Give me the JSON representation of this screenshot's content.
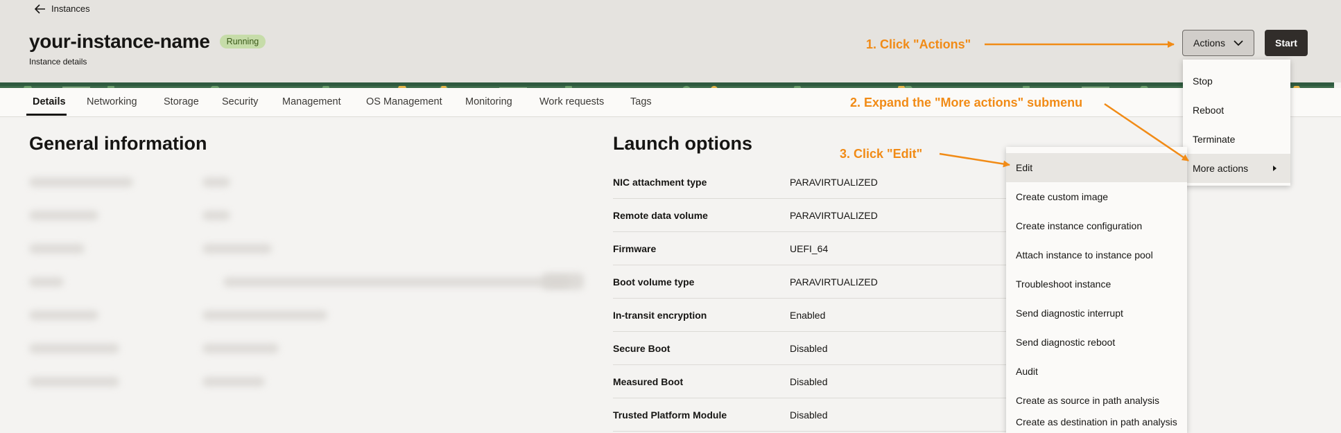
{
  "breadcrumb": {
    "back_label": "Instances"
  },
  "instance": {
    "name": "your-instance-name",
    "status": "Running",
    "subtitle": "Instance details"
  },
  "header_buttons": {
    "actions_label": "Actions",
    "start_label": "Start"
  },
  "tabs": [
    "Details",
    "Networking",
    "Storage",
    "Security",
    "Management",
    "OS Management",
    "Monitoring",
    "Work requests",
    "Tags"
  ],
  "active_tab": "Details",
  "general_info": {
    "title": "General information"
  },
  "launch_options": {
    "title": "Launch options",
    "rows": [
      {
        "key": "NIC attachment type",
        "value": "PARAVIRTUALIZED"
      },
      {
        "key": "Remote data volume",
        "value": "PARAVIRTUALIZED"
      },
      {
        "key": "Firmware",
        "value": "UEFI_64"
      },
      {
        "key": "Boot volume type",
        "value": "PARAVIRTUALIZED"
      },
      {
        "key": "In-transit encryption",
        "value": "Enabled"
      },
      {
        "key": "Secure Boot",
        "value": "Disabled"
      },
      {
        "key": "Measured Boot",
        "value": "Disabled"
      },
      {
        "key": "Trusted Platform Module",
        "value": "Disabled"
      }
    ]
  },
  "actions_menu": {
    "items": [
      "Stop",
      "Reboot",
      "Terminate",
      "More actions"
    ],
    "highlighted": "More actions"
  },
  "more_actions_menu": {
    "items": [
      "Edit",
      "Create custom image",
      "Create instance configuration",
      "Attach instance to instance pool",
      "Troubleshoot instance",
      "Send diagnostic interrupt",
      "Send diagnostic reboot",
      "Audit",
      "Create as source in path analysis",
      "Create as destination in path analysis"
    ],
    "highlighted": "Edit"
  },
  "annotations": {
    "step1": "1. Click \"Actions\"",
    "step2": "2. Expand the \"More actions\" submenu",
    "step3": "3. Click \"Edit\"",
    "color": "#f18b16"
  },
  "icons": {
    "back": "arrow-left-icon",
    "dropdown": "chevron-down-icon",
    "submenu": "chevron-right-icon"
  }
}
